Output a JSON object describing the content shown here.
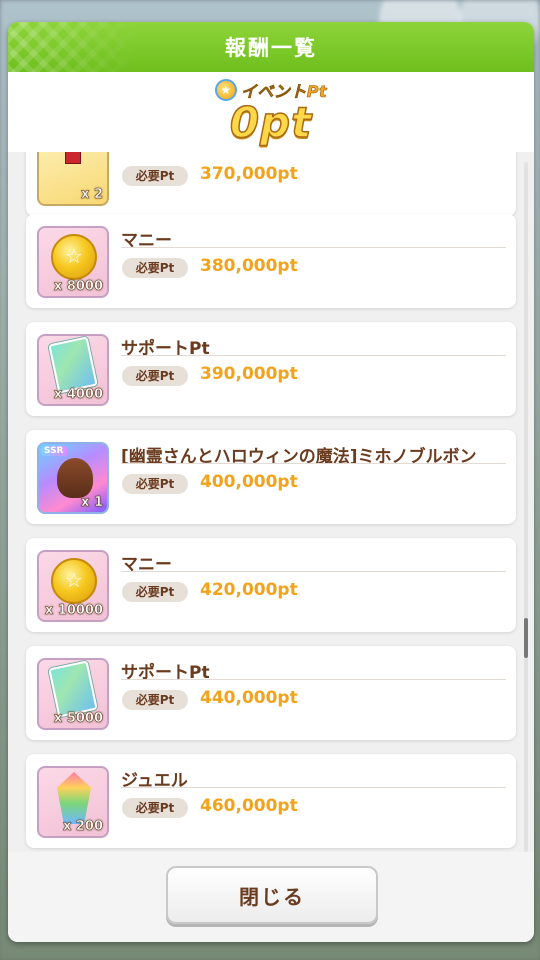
{
  "dialog": {
    "title": "報酬一覧",
    "event_pt_label": "イベントPt",
    "event_pt_value": "0pt",
    "close_label": "閉じる"
  },
  "required_label": "必要Pt",
  "rewards": [
    {
      "name": "",
      "qty": "x 2",
      "required": "370,000pt"
    },
    {
      "name": "マニー",
      "qty": "x 8000",
      "required": "380,000pt"
    },
    {
      "name": "サポートPt",
      "qty": "x 4000",
      "required": "390,000pt"
    },
    {
      "name": "[幽霊さんとハロウィンの魔法]ミホノブルボン",
      "qty": "x 1",
      "required": "400,000pt",
      "badge": "SSR"
    },
    {
      "name": "マニー",
      "qty": "x 10000",
      "required": "420,000pt"
    },
    {
      "name": "サポートPt",
      "qty": "x 5000",
      "required": "440,000pt"
    },
    {
      "name": "ジュエル",
      "qty": "x 200",
      "required": "460,000pt"
    }
  ]
}
